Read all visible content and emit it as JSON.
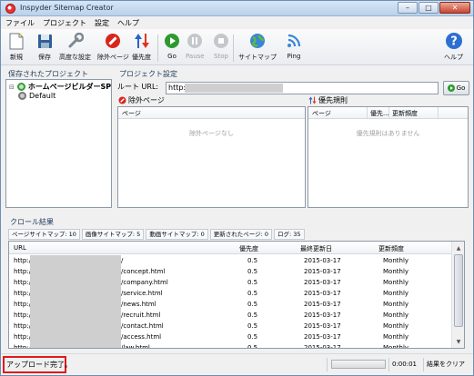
{
  "window": {
    "title": "Inspyder Sitemap Creator"
  },
  "menu": [
    "ファイル",
    "プロジェクト",
    "設定",
    "ヘルプ"
  ],
  "toolbar": {
    "new": "新規",
    "save": "保存",
    "advanced": "高度な設定",
    "exclude": "除外ページ",
    "priority": "優先度",
    "go": "Go",
    "pause": "Pause",
    "stop": "Stop",
    "sitemap": "サイトマップ",
    "ping": "Ping",
    "help": "ヘルプ"
  },
  "projects": {
    "heading": "保存されたプロジェクト",
    "items": [
      "ホームページビルダーSP",
      "Default"
    ]
  },
  "settings": {
    "heading": "プロジェクト設定",
    "root_url_label": "ルート URL:",
    "root_url_value": "http://",
    "go_label": "Go"
  },
  "excluded": {
    "heading": "除外ページ",
    "col_page": "ページ",
    "empty": "除外ページなし"
  },
  "priority_rules": {
    "heading": "優先規則",
    "col_page": "ページ",
    "col_priority": "優先...",
    "col_frequency": "更新頻度",
    "empty": "優先規則はありません"
  },
  "crawl": {
    "heading": "クロール結果",
    "tabs": [
      "ページサイトマップ: 10",
      "画像サイトマップ: 5",
      "動画サイトマップ: 0",
      "更新されたページ: 0",
      "ログ: 35"
    ],
    "columns": {
      "url": "URL",
      "priority": "優先度",
      "lastmod": "最終更新日",
      "freq": "更新頻度"
    },
    "rows": [
      {
        "prefix": "http://",
        "path": "/",
        "priority": "0.5",
        "lastmod": "2015-03-17",
        "freq": "Monthly"
      },
      {
        "prefix": "http://",
        "path": "/concept.html",
        "priority": "0.5",
        "lastmod": "2015-03-17",
        "freq": "Monthly"
      },
      {
        "prefix": "http://",
        "path": "/company.html",
        "priority": "0.5",
        "lastmod": "2015-03-17",
        "freq": "Monthly"
      },
      {
        "prefix": "http://",
        "path": "/service.html",
        "priority": "0.5",
        "lastmod": "2015-03-17",
        "freq": "Monthly"
      },
      {
        "prefix": "http://",
        "path": "/news.html",
        "priority": "0.5",
        "lastmod": "2015-03-17",
        "freq": "Monthly"
      },
      {
        "prefix": "http://",
        "path": "/recruit.html",
        "priority": "0.5",
        "lastmod": "2015-03-17",
        "freq": "Monthly"
      },
      {
        "prefix": "http://",
        "path": "/contact.html",
        "priority": "0.5",
        "lastmod": "2015-03-17",
        "freq": "Monthly"
      },
      {
        "prefix": "http://",
        "path": "/access.html",
        "priority": "0.5",
        "lastmod": "2015-03-17",
        "freq": "Monthly"
      },
      {
        "prefix": "http://",
        "path": "/law.html",
        "priority": "0.5",
        "lastmod": "2015-03-17",
        "freq": "Monthly"
      }
    ]
  },
  "status": {
    "message": "アップロード完了。",
    "elapsed": "0:00:01",
    "clear": "結果をクリア"
  },
  "colors": {
    "highlight": "#e0191b",
    "accent": "#1e395b"
  }
}
